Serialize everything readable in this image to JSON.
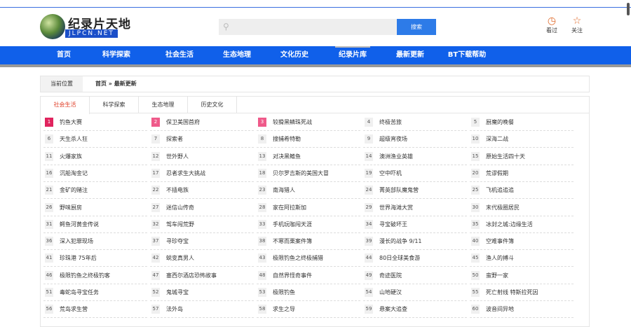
{
  "logo": {
    "cn": "纪录片天地",
    "en": "JLPCN.NET"
  },
  "search": {
    "placeholder": "",
    "button": "搜索"
  },
  "header_icons": [
    {
      "icon": "history-icon",
      "label": "看过"
    },
    {
      "icon": "star-icon",
      "label": "关注"
    }
  ],
  "nav": [
    "首页",
    "科学探索",
    "社会生活",
    "生态地理",
    "文化历史",
    "纪录片库",
    "最新更新",
    "BT下载帮助"
  ],
  "nav_active": "纪录片库",
  "breadcrumb": {
    "label": "当前位置",
    "path": "首页 » 最新更新"
  },
  "tabs": [
    "社会生活",
    "科学探索",
    "生态地理",
    "历史文化"
  ],
  "active_tab": "社会生活",
  "items": [
    "钓鱼大赛",
    "保卫美国首府",
    "较猾黑鳞珠死战",
    "终极苦旅",
    "厨魔的晚餐",
    "天生杀人狂",
    "探索者",
    "搜捕希特勒",
    "超级宵夜场",
    "深海二战",
    "火爆家族",
    "世外野人",
    "对决黑鳍鱼",
    "澳洲渔业英雄",
    "原始生活四十天",
    "沉船淘金记",
    "忍者求生大挑战",
    "贝尔罗吉斯的美国大冒",
    "空中吓机",
    "荒谬假期",
    "金矿的赌注",
    "不插电族",
    "南海猎人",
    "菁英部队魔鬼营",
    "飞机追追追",
    "野味厨房",
    "迷信山传奇",
    "家在阿拉斯加",
    "世界海滩大赏",
    "末代极圈居民",
    "鳄鱼河黄金传说",
    "驾车闯荒野",
    "手机玩咖闯天涯",
    "寻宝破坏王",
    "冰封之城:边缘生活",
    "深入犯罪现场",
    "寻珍夺宝",
    "不寒而栗案件簿",
    "漫长的战争 9/11",
    "空难事件簿",
    "珍珠港 75年后",
    "蜕变真男人",
    "极限钓鱼之终极捕猎",
    "80日全球美食游",
    "渔人的搏斗",
    "极限钓鱼之终极钓客",
    "塞西尔酒店恐怖故事",
    "自然界怪奇事件",
    "奇迹医院",
    "蛮野一家",
    "毒蛇岛寻宝任务",
    "鬼城寻宝",
    "极限钓鱼",
    "山地硬汉",
    "死亡射线 特斯拉死因",
    "荒岛求生营",
    "法外岛",
    "求生之导",
    "悬案大追查",
    "波音间异地"
  ],
  "colors": {
    "nav": "#1060ea",
    "accent": "#e0412a",
    "rank1": "#e0245e",
    "rank23": "#ef5a8a"
  }
}
